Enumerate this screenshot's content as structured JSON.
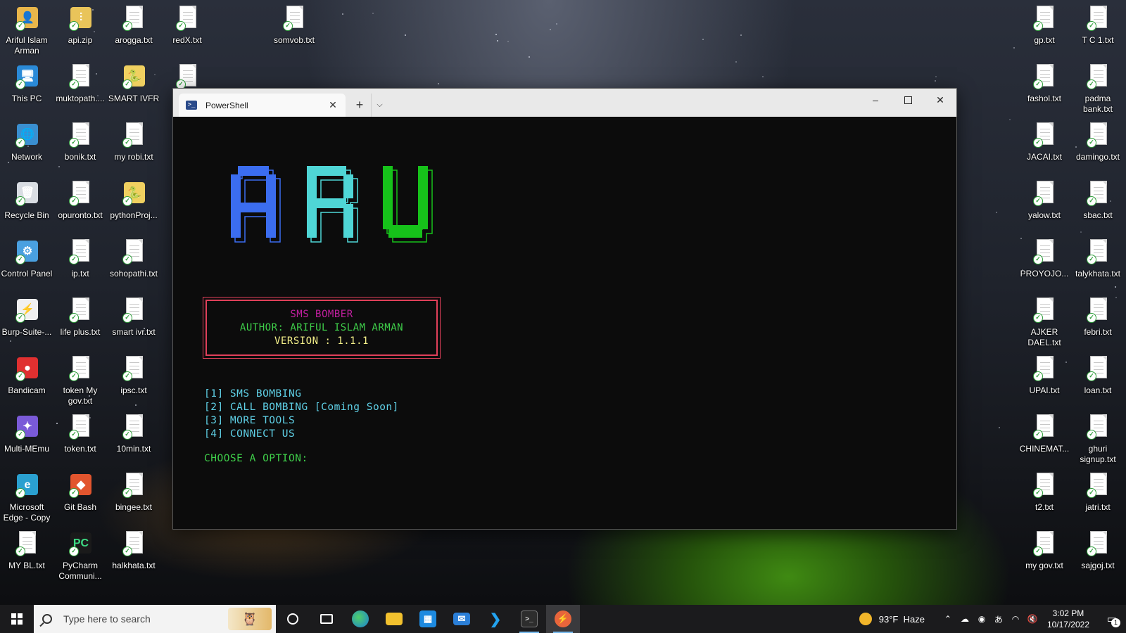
{
  "desktop": {
    "left_icons": [
      {
        "label": "Ariful Islam Arman",
        "kind": "user-folder-icon",
        "col": 0,
        "row": 0
      },
      {
        "label": "api.zip",
        "kind": "zip-folder-icon",
        "col": 1,
        "row": 0
      },
      {
        "label": "arogga.txt",
        "kind": "text-file-icon",
        "col": 2,
        "row": 0
      },
      {
        "label": "redX.txt",
        "kind": "text-file-icon",
        "col": 3,
        "row": 0
      },
      {
        "label": "somvob.txt",
        "kind": "text-file-icon",
        "col": 5,
        "row": 0
      },
      {
        "label": "This PC",
        "kind": "this-pc-icon",
        "col": 0,
        "row": 1
      },
      {
        "label": "muktopath....",
        "kind": "text-file-icon",
        "col": 1,
        "row": 1
      },
      {
        "label": "SMART IVFR",
        "kind": "python-file-icon",
        "col": 2,
        "row": 1
      },
      {
        "label": "",
        "kind": "text-file-icon",
        "col": 3,
        "row": 1
      },
      {
        "label": "Network",
        "kind": "network-icon",
        "col": 0,
        "row": 2
      },
      {
        "label": "bonik.txt",
        "kind": "text-file-icon",
        "col": 1,
        "row": 2
      },
      {
        "label": "my robi.txt",
        "kind": "text-file-icon",
        "col": 2,
        "row": 2
      },
      {
        "label": "Recycle Bin",
        "kind": "recycle-bin-icon",
        "col": 0,
        "row": 3
      },
      {
        "label": "opuronto.txt",
        "kind": "text-file-icon",
        "col": 1,
        "row": 3
      },
      {
        "label": "pythonProj...",
        "kind": "python-file-icon",
        "col": 2,
        "row": 3
      },
      {
        "label": "Control Panel",
        "kind": "control-panel-icon",
        "col": 0,
        "row": 4
      },
      {
        "label": "ip.txt",
        "kind": "text-file-icon",
        "col": 1,
        "row": 4
      },
      {
        "label": "sohopathi.txt",
        "kind": "text-file-icon",
        "col": 2,
        "row": 4
      },
      {
        "label": "Burp-Suite-...",
        "kind": "burp-suite-icon",
        "col": 0,
        "row": 5
      },
      {
        "label": "life plus.txt",
        "kind": "text-file-icon",
        "col": 1,
        "row": 5
      },
      {
        "label": "smart ivr.txt",
        "kind": "text-file-icon",
        "col": 2,
        "row": 5
      },
      {
        "label": "Bandicam",
        "kind": "bandicam-icon",
        "col": 0,
        "row": 6
      },
      {
        "label": "token My gov.txt",
        "kind": "text-file-icon",
        "col": 1,
        "row": 6
      },
      {
        "label": "ipsc.txt",
        "kind": "text-file-icon",
        "col": 2,
        "row": 6
      },
      {
        "label": "Multi-MEmu",
        "kind": "memu-icon",
        "col": 0,
        "row": 7
      },
      {
        "label": "token.txt",
        "kind": "text-file-icon",
        "col": 1,
        "row": 7
      },
      {
        "label": "10min.txt",
        "kind": "text-file-icon",
        "col": 2,
        "row": 7
      },
      {
        "label": "Microsoft Edge - Copy",
        "kind": "edge-icon",
        "col": 0,
        "row": 8
      },
      {
        "label": "Git Bash",
        "kind": "git-bash-icon",
        "col": 1,
        "row": 8
      },
      {
        "label": "bingee.txt",
        "kind": "text-file-icon",
        "col": 2,
        "row": 8
      },
      {
        "label": "MY BL.txt",
        "kind": "text-file-icon",
        "col": 0,
        "row": 9
      },
      {
        "label": "PyCharm Communi...",
        "kind": "pycharm-icon",
        "col": 1,
        "row": 9
      },
      {
        "label": "halkhata.txt",
        "kind": "text-file-icon",
        "col": 2,
        "row": 9
      }
    ],
    "right_icons": [
      {
        "label": "gp.txt",
        "col": 0,
        "row": 0
      },
      {
        "label": "T C 1.txt",
        "col": 1,
        "row": 0
      },
      {
        "label": "fashol.txt",
        "col": 0,
        "row": 1
      },
      {
        "label": "padma bank.txt",
        "col": 1,
        "row": 1
      },
      {
        "label": "JACAI.txt",
        "col": 0,
        "row": 2
      },
      {
        "label": "damingo.txt",
        "col": 1,
        "row": 2
      },
      {
        "label": "yalow.txt",
        "col": 0,
        "row": 3
      },
      {
        "label": "sbac.txt",
        "col": 1,
        "row": 3
      },
      {
        "label": "PROYOJO...",
        "col": 0,
        "row": 4
      },
      {
        "label": "talykhata.txt",
        "col": 1,
        "row": 4
      },
      {
        "label": "AJKER DAEL.txt",
        "col": 0,
        "row": 5
      },
      {
        "label": "febri.txt",
        "col": 1,
        "row": 5
      },
      {
        "label": "UPAI.txt",
        "col": 0,
        "row": 6
      },
      {
        "label": "loan.txt",
        "col": 1,
        "row": 6
      },
      {
        "label": "CHINEMAT...",
        "col": 0,
        "row": 7
      },
      {
        "label": "ghuri signup.txt",
        "col": 1,
        "row": 7
      },
      {
        "label": "t2.txt",
        "col": 0,
        "row": 8
      },
      {
        "label": "jatri.txt",
        "col": 1,
        "row": 8
      },
      {
        "label": "my gov.txt",
        "col": 0,
        "row": 9
      },
      {
        "label": "sajgoj.txt",
        "col": 1,
        "row": 9
      }
    ]
  },
  "window": {
    "tab_title": "PowerShell",
    "tab_icon": "powershell-icon",
    "controls": {
      "minimize": "–",
      "close": "✕",
      "new_tab": "+",
      "dropdown": "⌵"
    }
  },
  "terminal": {
    "ascii_logo": [
      "A",
      "R",
      "U"
    ],
    "logo_colors": [
      "#3b6df0",
      "#4fd6d6",
      "#16c21a"
    ],
    "banner": {
      "title": "SMS BOMBER",
      "author": "AUTHOR: ARIFUL ISLAM ARMAN",
      "version": "VERSION : 1.1.1",
      "title_color": "#c21fa0",
      "author_color": "#3fcf4a",
      "version_color": "#f4f08a",
      "border_color": "#e0405a"
    },
    "menu": [
      "[1] SMS BOMBING",
      "[2] CALL BOMBING [Coming Soon]",
      "[3] MORE TOOLS",
      "[4] CONNECT US"
    ],
    "prompt": "CHOOSE A OPTION:"
  },
  "taskbar": {
    "search_placeholder": "Type here to search",
    "apps": [
      "edge",
      "file-explorer",
      "microsoft-store",
      "mail",
      "vscode",
      "terminal",
      "burp-suite"
    ],
    "weather": {
      "temp": "93°F",
      "condition": "Haze"
    },
    "time": "3:02 PM",
    "date": "10/17/2022",
    "notification_count": "1"
  }
}
